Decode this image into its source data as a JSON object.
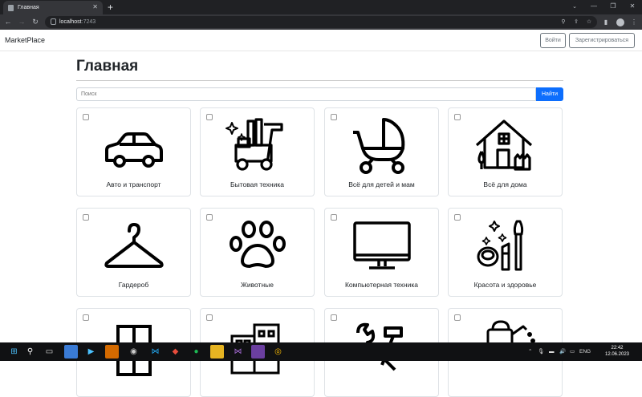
{
  "browser": {
    "tab_title": "Главная",
    "url_host": "localhost",
    "url_port": ":7243"
  },
  "navbar": {
    "brand": "MarketPlace",
    "login_label": "Войти",
    "register_label": "Зарегистрироваться"
  },
  "main": {
    "title": "Главная",
    "search_placeholder": "Поиск",
    "search_button": "Найти",
    "categories": [
      {
        "label": "Авто и транспорт",
        "icon": "car-icon"
      },
      {
        "label": "Бытовая техника",
        "icon": "vacuum-cleaner-icon"
      },
      {
        "label": "Всё для детей и мам",
        "icon": "baby-stroller-icon"
      },
      {
        "label": "Всё для дома",
        "icon": "house-icon"
      },
      {
        "label": "Гардероб",
        "icon": "hanger-icon"
      },
      {
        "label": "Животные",
        "icon": "paw-icon"
      },
      {
        "label": "Компьютерная техника",
        "icon": "monitor-icon"
      },
      {
        "label": "Красота и здоровье",
        "icon": "cosmetics-icon"
      },
      {
        "label": "",
        "icon": "wardrobe-icon"
      },
      {
        "label": "",
        "icon": "buildings-icon"
      },
      {
        "label": "",
        "icon": "tools-icon"
      },
      {
        "label": "",
        "icon": "watering-can-icon"
      }
    ]
  },
  "taskbar": {
    "lang": "ENG",
    "time": "22:42",
    "date": "12.06.2023"
  }
}
